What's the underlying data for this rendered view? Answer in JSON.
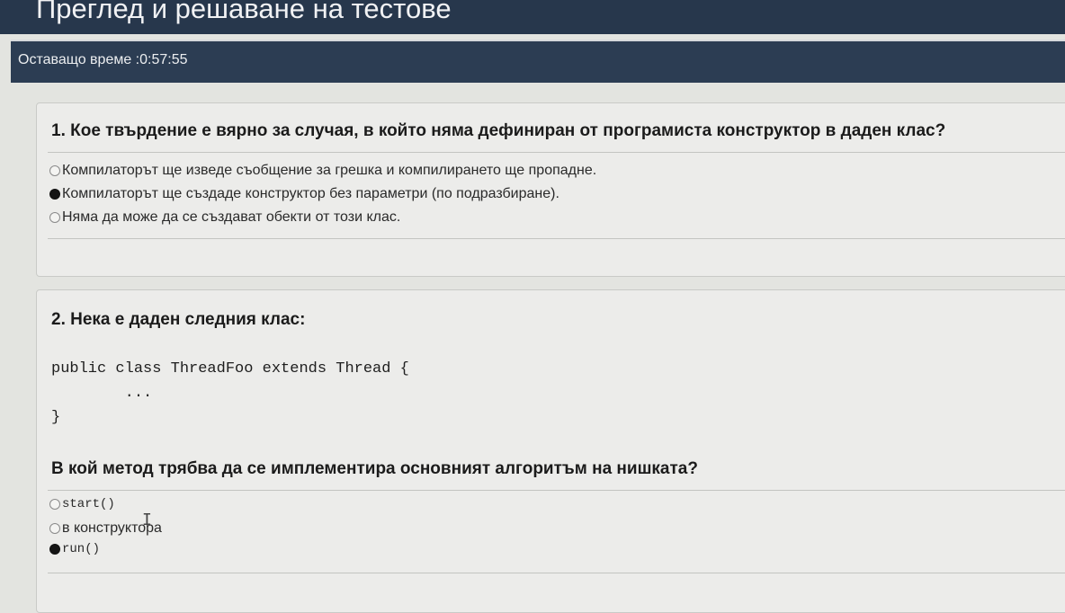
{
  "header": {
    "title": "Преглед и решаване на тестове"
  },
  "timer": {
    "text": "Оставащо време :0:57:55"
  },
  "questions": [
    {
      "title": "1. Кое твърдение е вярно за случая, в който няма дефиниран от програмиста конструктор в даден клас?",
      "options": [
        {
          "label": "Компилаторът ще изведе съобщение за грешка и компилирането ще пропадне.",
          "selected": false
        },
        {
          "label": "Компилаторът ще създаде конструктор без параметри (по подразбиране).",
          "selected": true
        },
        {
          "label": "Няма да може да се създават обекти от този клас.",
          "selected": false
        }
      ]
    },
    {
      "title": "2. Нека е даден следния клас:",
      "code": "public class ThreadFoo extends Thread {\n        ...\n}",
      "subtitle": "В кой метод трябва да се имплементира основният алгоритъм на нишката?",
      "options": [
        {
          "label": "start()",
          "selected": false
        },
        {
          "label": "в конструктора",
          "selected": false
        },
        {
          "label": "run()",
          "selected": true
        }
      ]
    }
  ]
}
